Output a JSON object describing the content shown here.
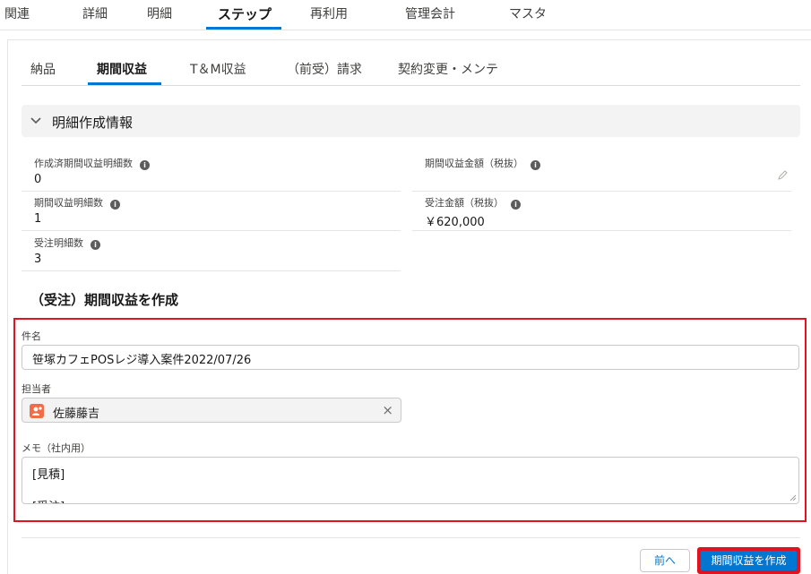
{
  "top_tabs": [
    "関連",
    "詳細",
    "明細",
    "ステップ",
    "再利用",
    "管理会計",
    "マスタ"
  ],
  "sub_tabs": [
    "納品",
    "期間収益",
    "T＆M収益",
    "（前受）請求",
    "契約変更・メンテ"
  ],
  "section": {
    "title": "明細作成情報"
  },
  "fields": {
    "created_count": {
      "label": "作成済期間収益明細数",
      "value": "0"
    },
    "revenue_count": {
      "label": "期間収益明細数",
      "value": "1"
    },
    "order_count": {
      "label": "受注明細数",
      "value": "3"
    },
    "revenue_amount": {
      "label": "期間収益金額（税抜）",
      "value": ""
    },
    "order_amount": {
      "label": "受注金額（税抜）",
      "value": "￥620,000"
    }
  },
  "form": {
    "heading": "（受注）期間収益を作成",
    "subject_label": "件名",
    "subject_value": "笹塚カフェPOSレジ導入案件2022/07/26",
    "owner_label": "担当者",
    "owner_value": "佐藤藤吉",
    "memo_label": "メモ（社内用）",
    "memo_lines": [
      "[見積]",
      "[受注]"
    ]
  },
  "buttons": {
    "prev": "前へ",
    "create": "期間収益を作成"
  },
  "colors": {
    "accent": "#0176d3",
    "highlight": "#e3121f",
    "avatar": "#f26d47"
  },
  "icons": [
    "chevron-down-icon",
    "info-icon",
    "pencil-icon",
    "user-icon",
    "close-icon",
    "resize-handle-icon"
  ]
}
